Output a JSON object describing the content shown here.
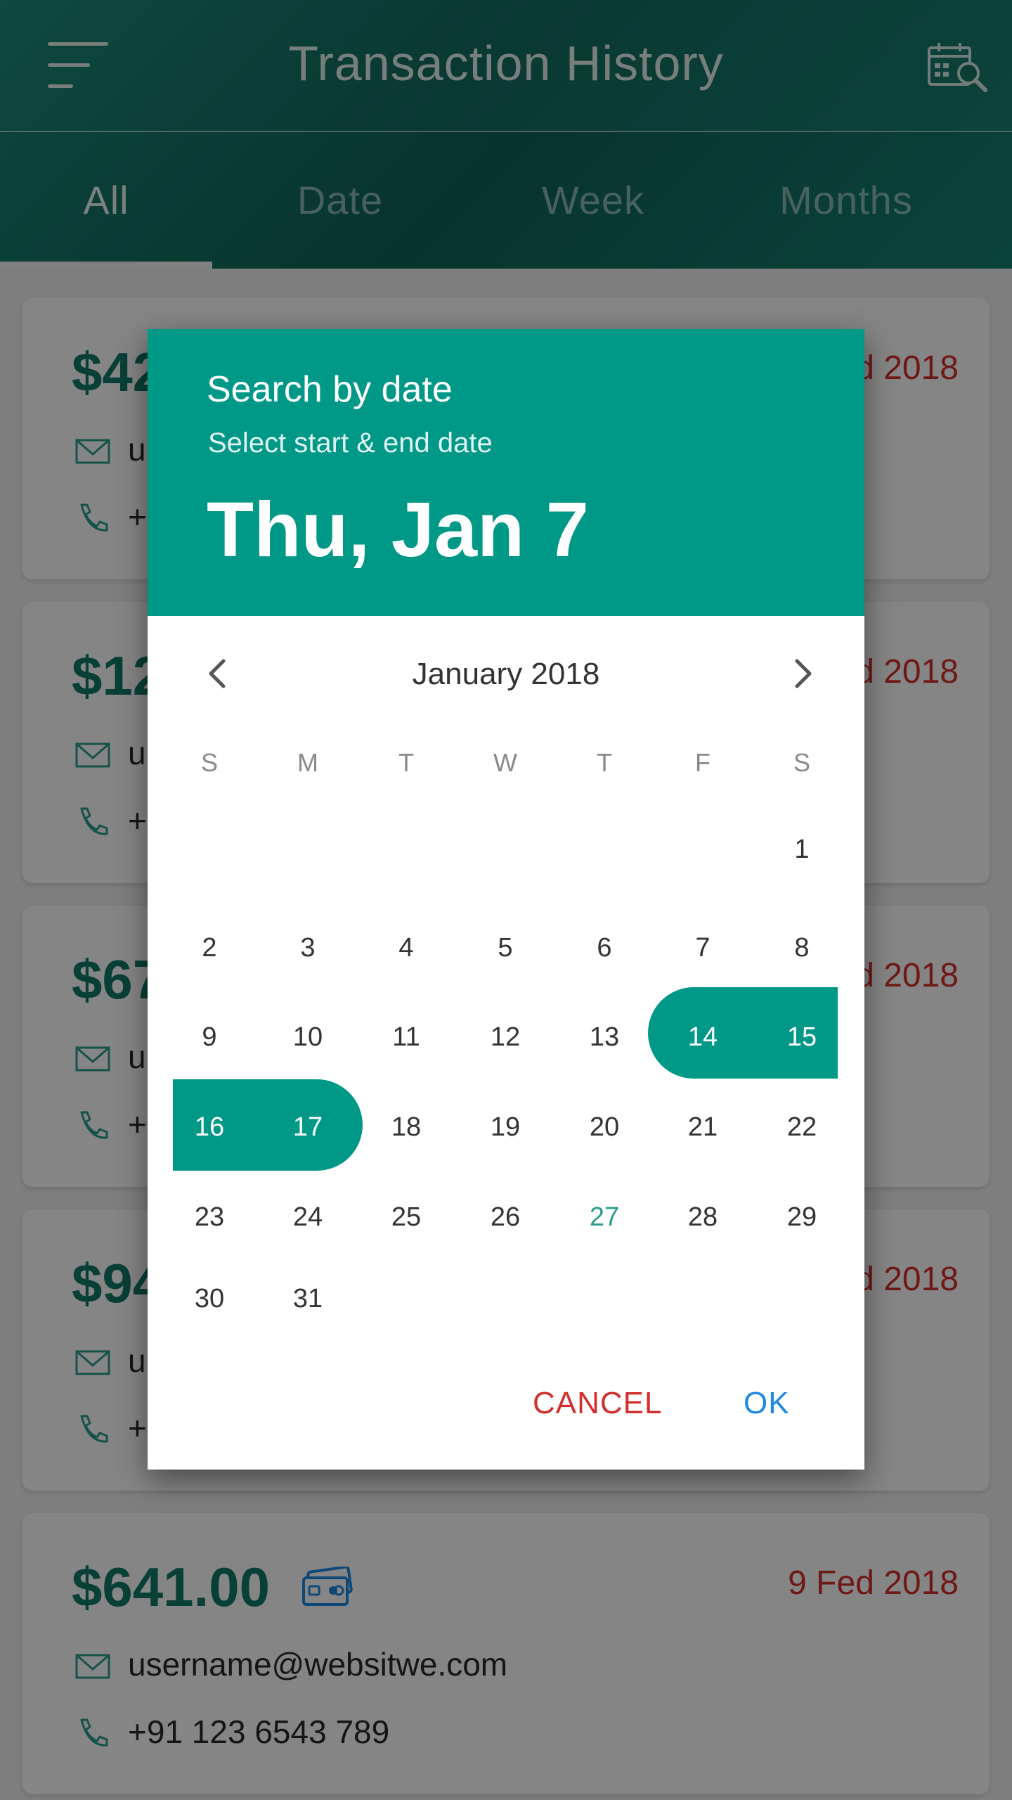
{
  "app": {
    "title": "Transaction History"
  },
  "tabs": [
    {
      "label": "All",
      "active": true
    },
    {
      "label": "Date",
      "active": false
    },
    {
      "label": "Week",
      "active": false
    },
    {
      "label": "Months",
      "active": false
    }
  ],
  "transactions": [
    {
      "amount": "$42",
      "date": "d 2018",
      "email": "u",
      "phone": "+"
    },
    {
      "amount": "$12",
      "date": "d 2018",
      "email": "u",
      "phone": "+"
    },
    {
      "amount": "$67",
      "date": "d 2018",
      "email": "u",
      "phone": "+"
    },
    {
      "amount": "$94",
      "date": "d 2018",
      "email": "u",
      "phone": "+"
    },
    {
      "amount": "$641.00",
      "date": "9 Fed 2018",
      "email": "username@websitwe.com",
      "phone": "+91 123 6543 789"
    }
  ],
  "dialog": {
    "title": "Search by date",
    "subtitle": "Select start & end date",
    "selected_date": "Thu, Jan 7",
    "month_label": "January 2018",
    "weekdays": [
      "S",
      "M",
      "T",
      "W",
      "T",
      "F",
      "S"
    ],
    "days": [
      "1",
      "2",
      "3",
      "4",
      "5",
      "6",
      "7",
      "8",
      "9",
      "10",
      "11",
      "12",
      "13",
      "14",
      "15",
      "16",
      "17",
      "18",
      "19",
      "20",
      "21",
      "22",
      "23",
      "24",
      "25",
      "26",
      "27",
      "28",
      "29",
      "30",
      "31"
    ],
    "range_start": 14,
    "range_end": 17,
    "today": 27,
    "cancel_label": "CANCEL",
    "ok_label": "OK"
  },
  "colors": {
    "primary": "#009886",
    "header": "#136e60",
    "amount": "#11796a",
    "date_red": "#d32f2f",
    "ok_blue": "#1e88e5"
  },
  "icons": {
    "menu": "menu-icon",
    "calendar_search": "calendar-search-icon",
    "card": "credit-card-icon",
    "mail": "mail-icon",
    "phone": "phone-icon",
    "prev": "chevron-left-icon",
    "next": "chevron-right-icon"
  }
}
